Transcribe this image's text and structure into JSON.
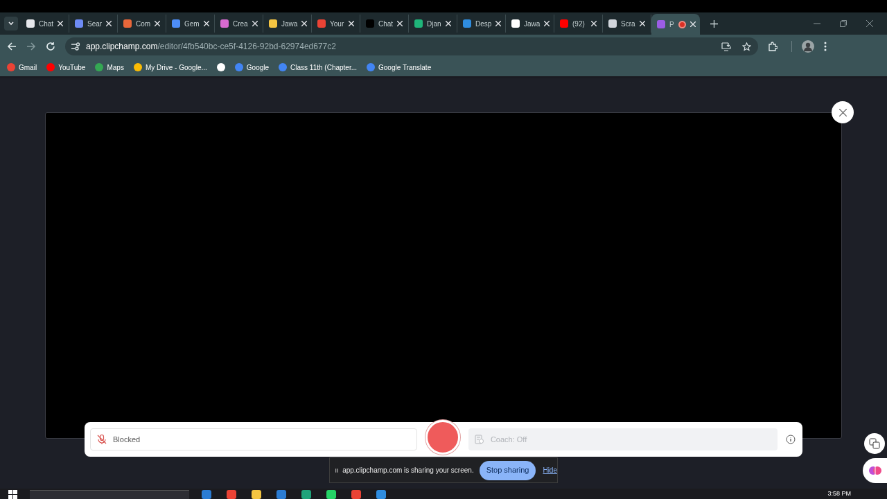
{
  "tabs": [
    {
      "title": "Chat",
      "color": "#e5e7eb",
      "selected": false
    },
    {
      "title": "Sear",
      "color": "#6d8bf5",
      "selected": false
    },
    {
      "title": "Com",
      "color": "#e8673a",
      "selected": false
    },
    {
      "title": "Gem",
      "color": "#4d8df7",
      "selected": false
    },
    {
      "title": "Crea",
      "color": "#d86ad0",
      "selected": false
    },
    {
      "title": "Jawa",
      "color": "#f5c542",
      "selected": false
    },
    {
      "title": "Your",
      "color": "#ea4335",
      "selected": false
    },
    {
      "title": "Chat",
      "color": "#000000",
      "selected": false
    },
    {
      "title": "Djan",
      "color": "#1fb57a",
      "selected": false
    },
    {
      "title": "Desp",
      "color": "#2f8de0",
      "selected": false
    },
    {
      "title": "Jawa",
      "color": "#ffffff",
      "selected": false
    },
    {
      "title": "(92)",
      "color": "#ff0000",
      "selected": false
    },
    {
      "title": "Scra",
      "color": "#d1d5db",
      "selected": false
    },
    {
      "title": "P",
      "color": "#9b5de5",
      "selected": true,
      "recording": true
    }
  ],
  "address": {
    "host": "app.clipchamp.com",
    "path": "/editor/4fb540bc-ce5f-4126-92bd-62974ed677c2"
  },
  "bookmarks": [
    {
      "label": "Gmail",
      "color": "#ea4335"
    },
    {
      "label": "YouTube",
      "color": "#ff0000"
    },
    {
      "label": "Maps",
      "color": "#34a853"
    },
    {
      "label": "My Drive - Google...",
      "color": "#fbbc04"
    },
    {
      "color": "#ffffff"
    },
    {
      "label": "Google",
      "color": "#4285f4"
    },
    {
      "label": "Class 11th (Chapter...",
      "color": "#4285f4"
    },
    {
      "label": "Google Translate",
      "color": "#4285f4"
    }
  ],
  "recorder": {
    "microphone": {
      "label": "Blocked"
    },
    "coach": {
      "label": "Coach: Off",
      "disabled": true
    }
  },
  "sharing_bar": {
    "message": "app.clipchamp.com is sharing your screen.",
    "stop_button": "Stop sharing",
    "hide_link": "Hide"
  },
  "taskbar": {
    "time": "3:58 PM"
  }
}
